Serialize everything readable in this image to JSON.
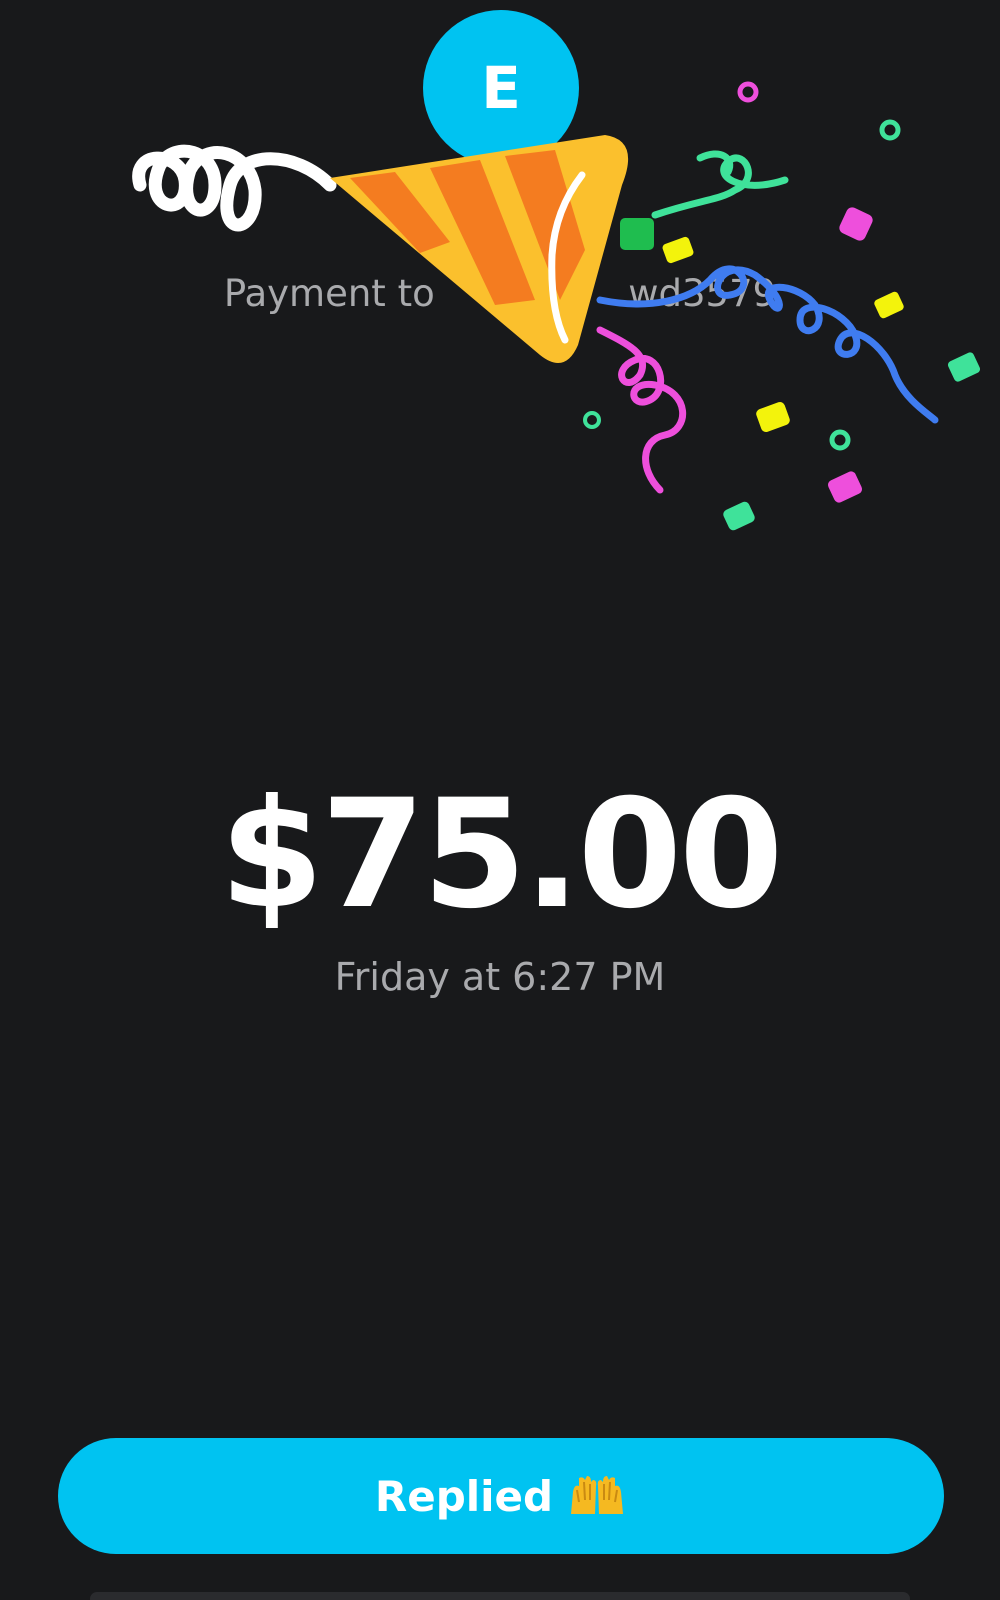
{
  "recipient": {
    "avatar_initial": "E",
    "name": "E",
    "payment_prefix": "Payment to",
    "cashtag": "wd3579",
    "payment_line": "Payment to  $  wd3579"
  },
  "payment": {
    "amount": "$75.00",
    "timestamp": "Friday at 6:27 PM"
  },
  "reply_button": {
    "label": "Replied",
    "emoji": "raising-hands-icon"
  },
  "colors": {
    "background": "#18191b",
    "accent": "#00c3f1",
    "secondary_text": "#a9aaad",
    "party_hat_yellow": "#fbc02d",
    "party_hat_orange": "#f47c20",
    "streamer_blue": "#3f7cf0",
    "streamer_pink": "#ee4fdc",
    "streamer_green": "#3fe29a"
  },
  "decorations": {
    "overlay": "party-popper-celebration"
  }
}
